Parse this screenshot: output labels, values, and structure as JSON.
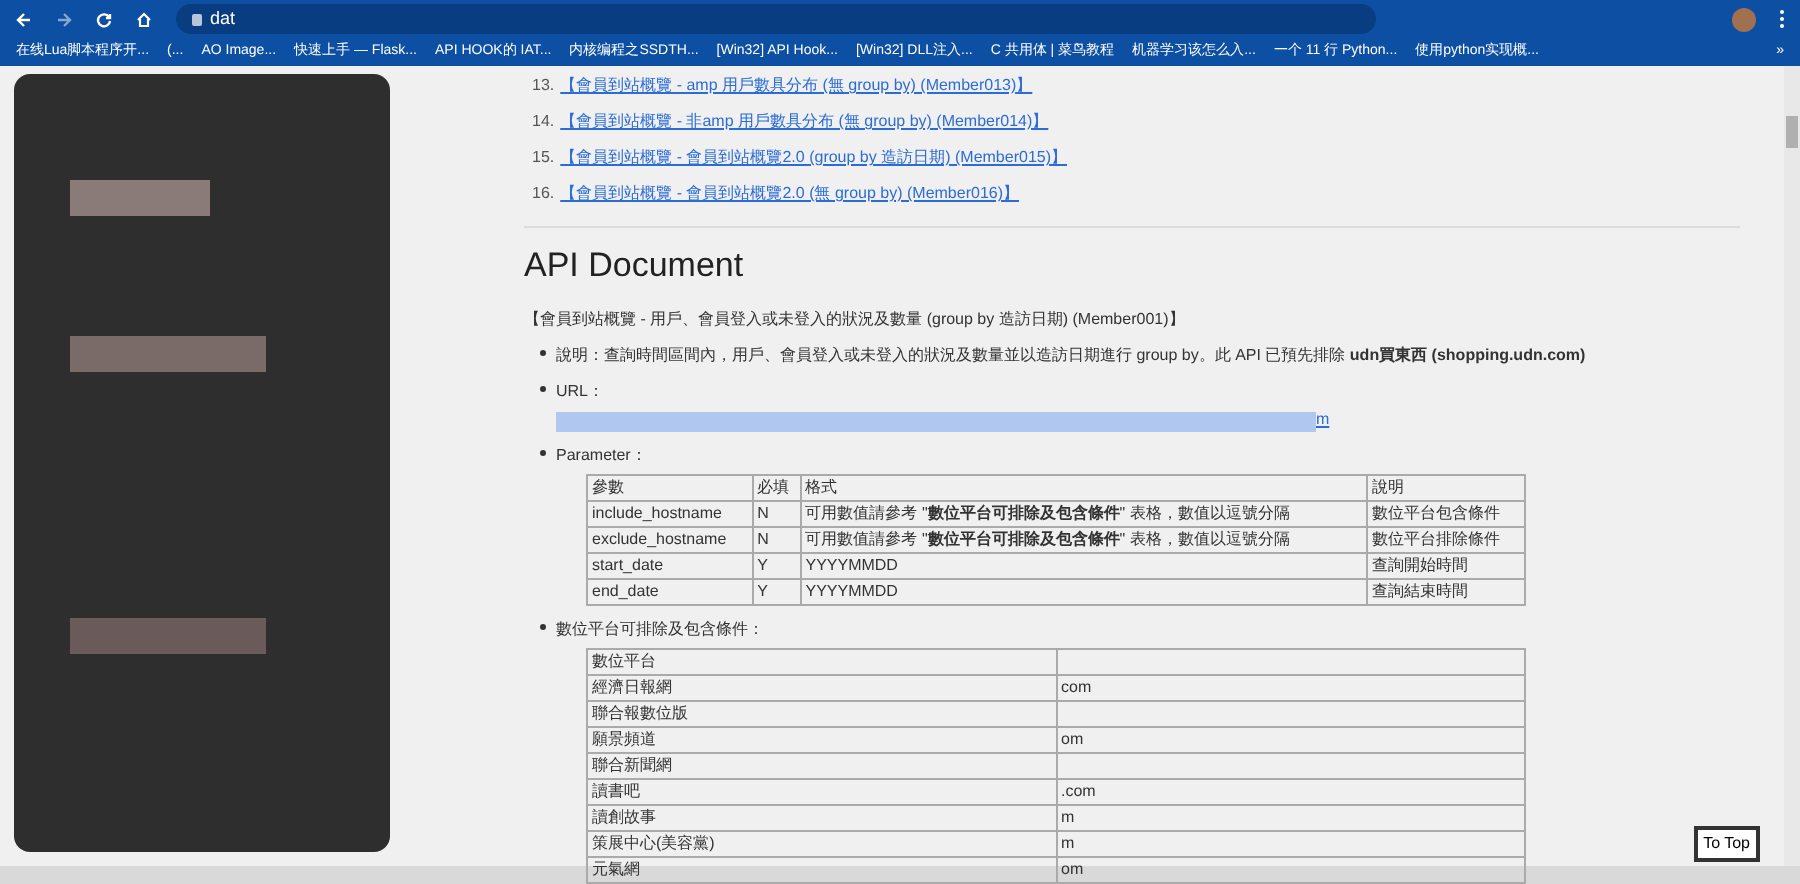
{
  "browser": {
    "address": "dat",
    "bookmarks": [
      "在线Lua脚本程序开...",
      "(...",
      "AO Image...",
      "快速上手 — Flask...",
      "API HOOK的 IAT...",
      "内核编程之SSDTH...",
      "[Win32] API Hook...",
      "[Win32] DLL注入...",
      "C 共用体 | 菜鸟教程",
      "机器学习该怎么入...",
      "一个 11 行 Python...",
      "使用python实现概..."
    ],
    "more": "»"
  },
  "links": [
    {
      "number": "13.",
      "text": "【會員到站概覽 - amp 用戶數具分布 (無 group by) (Member013)】"
    },
    {
      "number": "14.",
      "text": "【會員到站概覽 - 非amp 用戶數具分布 (無 group by) (Member014)】"
    },
    {
      "number": "15.",
      "text": "【會員到站概覽 - 會員到站概覽2.0 (group by 造訪日期) (Member015)】"
    },
    {
      "number": "16.",
      "text": "【會員到站概覽 - 會員到站概覽2.0 (無 group by) (Member016)】"
    }
  ],
  "heading": "API Document",
  "section_title": "【會員到站概覽 - 用戶、會員登入或未登入的狀況及數量 (group by 造訪日期) (Member001)】",
  "description": "說明：查詢時間區間內，用戶、會員登入或未登入的狀況及數量並以造訪日期進行 group by。此 API 已預先排除 **udn買東西 (shopping.udn.com)**",
  "url_label": "URL：",
  "url_tail": "m",
  "parameter_label": "Parameter：",
  "param_table": {
    "columns": [
      "參數",
      "必填",
      "格式",
      "說明"
    ],
    "rows": [
      [
        "include_hostname",
        "N",
        "可用數值請參考 \"**數位平台可排除及包含條件**\" 表格，數值以逗號分隔",
        "數位平台包含條件"
      ],
      [
        "exclude_hostname",
        "N",
        "可用數值請參考 \"**數位平台可排除及包含條件**\" 表格，數值以逗號分隔",
        "數位平台排除條件"
      ],
      [
        "start_date",
        "Y",
        "YYYYMMDD",
        "查詢開始時間"
      ],
      [
        "end_date",
        "Y",
        "YYYYMMDD",
        "查詢結束時間"
      ]
    ]
  },
  "platform_label": "數位平台可排除及包含條件：",
  "platform_table": {
    "rows": [
      [
        "數位平台",
        ""
      ],
      [
        "經濟日報網",
        "com"
      ],
      [
        "聯合報數位版",
        ""
      ],
      [
        "願景頻道",
        "om"
      ],
      [
        "聯合新聞網",
        ""
      ],
      [
        "讀書吧",
        ".com"
      ],
      [
        "讀創故事",
        "m"
      ],
      [
        "策展中心(美容黨)",
        "m"
      ],
      [
        "元氣網",
        "om"
      ]
    ]
  },
  "to_top": "To Top"
}
